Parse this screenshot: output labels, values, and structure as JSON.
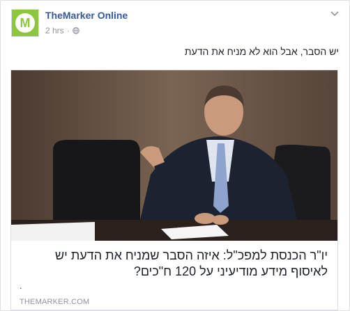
{
  "post": {
    "page_name": "TheMarker Online",
    "avatar_letter": "M",
    "timestamp": "2 hrs",
    "separator": "·",
    "privacy_icon": "globe-icon",
    "menu_icon": "chevron-down-icon",
    "text": "יש הסבר, אבל הוא לא מניח את הדעת"
  },
  "link": {
    "headline": "יו\"ר הכנסת למפכ\"ל: איזה הסבר שמניח את הדעת יש לאיסוף מידע מודיעיני על 120 ח\"כים?",
    "description": ".",
    "domain": "THEMARKER.COM"
  },
  "colors": {
    "brand_green": "#8dc63f",
    "link_blue": "#365899",
    "meta_gray": "#90949c"
  }
}
